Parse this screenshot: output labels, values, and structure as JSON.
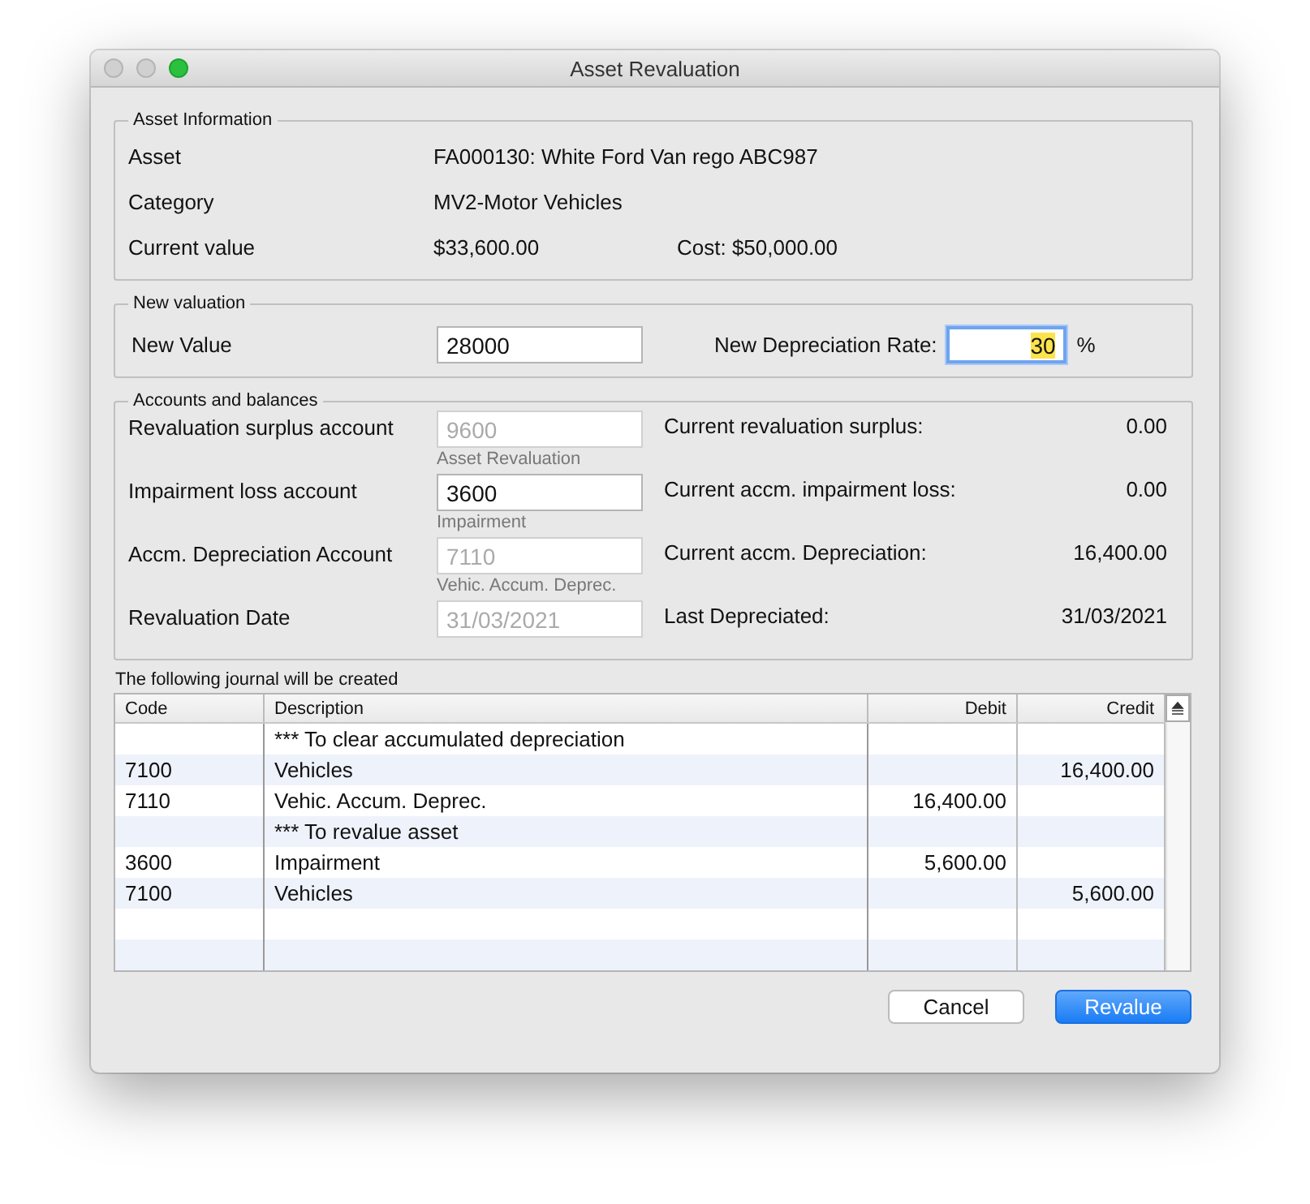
{
  "window": {
    "title": "Asset Revaluation"
  },
  "asset_information": {
    "title": "Asset Information",
    "rows": [
      {
        "label": "Asset",
        "value": "FA000130: White Ford Van rego ABC987"
      },
      {
        "label": "Category",
        "value": "MV2-Motor Vehicles"
      },
      {
        "label": "Current value",
        "value": "$33,600.00",
        "extra": "Cost: $50,000.00"
      }
    ]
  },
  "new_valuation": {
    "title": "New valuation",
    "value_label": "New Value",
    "value": "28000",
    "rate_label": "New Depreciation Rate:",
    "rate": "30",
    "rate_focused": true,
    "rate_unit": "%"
  },
  "accounts": {
    "title": "Accounts and balances",
    "rows": [
      {
        "label": "Revaluation surplus account",
        "value": "9600",
        "disabled": true,
        "caption": "Asset Revaluation",
        "balance_label": "Current revaluation surplus:",
        "balance": "0.00"
      },
      {
        "label": "Impairment loss account",
        "value": "3600",
        "disabled": false,
        "caption": "Impairment",
        "balance_label": "Current accm. impairment loss:",
        "balance": "0.00"
      },
      {
        "label": "Accm. Depreciation Account",
        "value": "7110",
        "disabled": true,
        "caption": "Vehic. Accum. Deprec.",
        "balance_label": "Current accm. Depreciation:",
        "balance": "16,400.00"
      },
      {
        "label": "Revaluation Date",
        "value": "31/03/2021",
        "disabled": true,
        "balance_label": "Last Depreciated:",
        "balance": "31/03/2021"
      }
    ]
  },
  "journal": {
    "caption": "The following journal will be created",
    "columns": [
      "Code",
      "Description",
      "Debit",
      "Credit"
    ],
    "rows": [
      {
        "code": "",
        "description": "*** To clear accumulated depreciation",
        "debit": "",
        "credit": ""
      },
      {
        "code": "7100",
        "description": "Vehicles",
        "debit": "",
        "credit": "16,400.00"
      },
      {
        "code": "7110",
        "description": "Vehic. Accum. Deprec.",
        "debit": "16,400.00",
        "credit": ""
      },
      {
        "code": "",
        "description": "*** To revalue asset",
        "debit": "",
        "credit": ""
      },
      {
        "code": "3600",
        "description": "Impairment",
        "debit": "5,600.00",
        "credit": ""
      },
      {
        "code": "7100",
        "description": "Vehicles",
        "debit": "",
        "credit": "5,600.00"
      }
    ]
  },
  "buttons": [
    {
      "label": "Cancel",
      "kind": "secondary"
    },
    {
      "label": "Revalue",
      "kind": "primary"
    }
  ]
}
